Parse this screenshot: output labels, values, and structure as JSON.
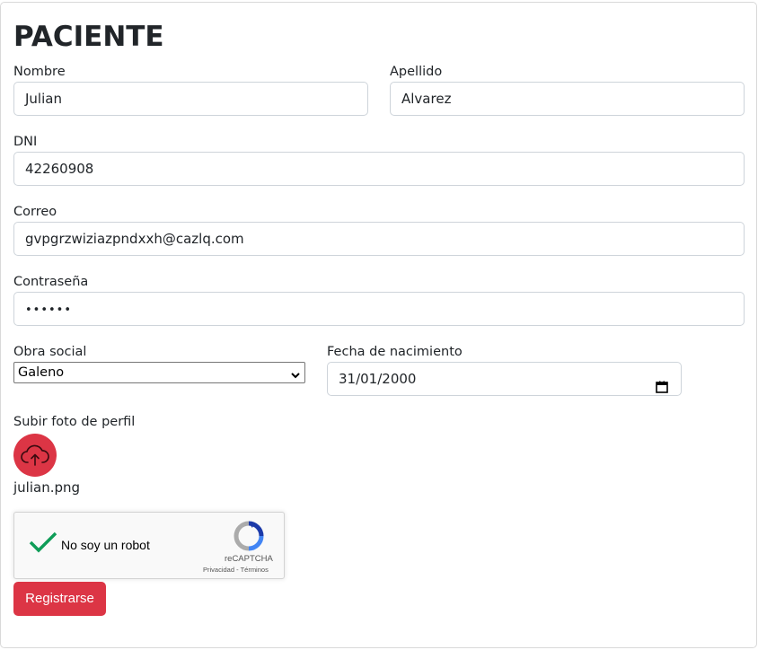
{
  "form": {
    "title": "PACIENTE",
    "nombre": {
      "label": "Nombre",
      "value": "Julian"
    },
    "apellido": {
      "label": "Apellido",
      "value": "Alvarez"
    },
    "dni": {
      "label": "DNI",
      "value": "42260908"
    },
    "correo": {
      "label": "Correo",
      "value": "gvpgrzwiziazpndxxh@cazlq.com"
    },
    "contrasena": {
      "label": "Contraseña",
      "value": "••••••"
    },
    "obra_social": {
      "label": "Obra social",
      "selected": "Galeno"
    },
    "fecha_nacimiento": {
      "label": "Fecha de nacimiento",
      "value": "31/01/2000"
    },
    "foto": {
      "label": "Subir foto de perfil",
      "filename": "julian.png"
    },
    "captcha": {
      "label": "No soy un robot",
      "brand": "reCAPTCHA",
      "privacy": "Privacidad",
      "separator": " - ",
      "terms": "Términos"
    },
    "submit_label": "Registrarse"
  },
  "colors": {
    "accent": "#dc3545",
    "check": "#0f9d58",
    "border": "#ced4da",
    "text": "#212529"
  },
  "icons": {
    "upload": "cloud-upload-icon",
    "calendar": "calendar-icon",
    "dropdown": "chevron-down-icon",
    "captcha_check": "checkmark-icon",
    "captcha_logo": "recaptcha-logo-icon"
  }
}
